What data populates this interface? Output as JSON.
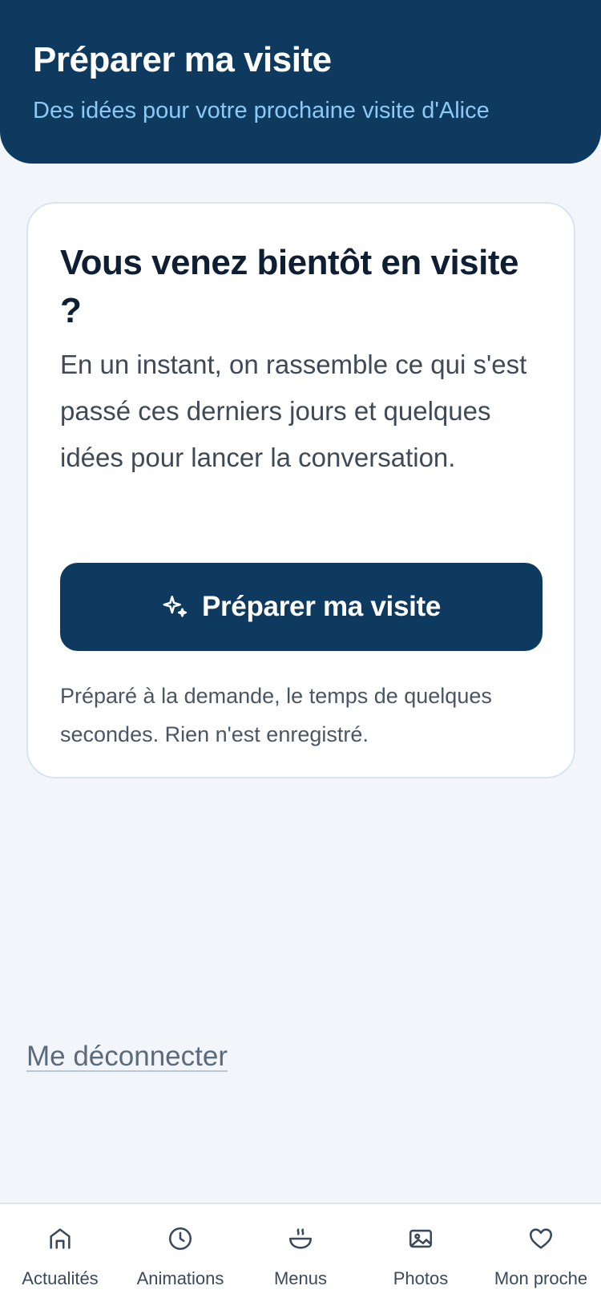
{
  "header": {
    "title": "Préparer ma visite",
    "subtitle": "Des idées pour votre prochaine visite d'Alice"
  },
  "card": {
    "title": "Vous venez bientôt en visite ?",
    "body": "En un instant, on rassemble ce qui s'est passé ces derniers jours et quelques idées pour lancer la conversation.",
    "button_label": "Préparer ma visite",
    "button_icon": "sparkles-icon",
    "note": "Préparé à la demande, le temps de quelques secondes. Rien n'est enregistré."
  },
  "logout_label": "Me déconnecter",
  "nav": {
    "items": [
      {
        "label": "Actualités",
        "icon": "home-icon"
      },
      {
        "label": "Animations",
        "icon": "clock-icon"
      },
      {
        "label": "Menus",
        "icon": "bowl-icon"
      },
      {
        "label": "Photos",
        "icon": "image-icon"
      },
      {
        "label": "Mon proche",
        "icon": "heart-icon"
      }
    ]
  },
  "colors": {
    "primary": "#0f3a5f",
    "subtitle": "#8cc9f5",
    "background": "#f2f6fa"
  }
}
